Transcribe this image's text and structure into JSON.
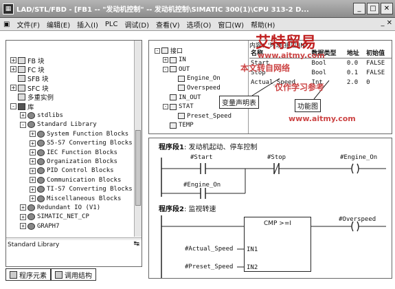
{
  "window": {
    "title": "LAD/STL/FBD  - [FB1 -- \"发动机控制\" -- 发动机控制\\SIMATIC 300(1)\\CPU 313-2 D...",
    "buttons": [
      "_",
      "□",
      "✕"
    ]
  },
  "menu": {
    "items": [
      "文件(F)",
      "编辑(E)",
      "插入(I)",
      "PLC",
      "调试(D)",
      "查看(V)",
      "选项(O)",
      "窗口(W)",
      "帮助(H)"
    ],
    "controls": "_ ✕"
  },
  "left_tree": {
    "items": [
      {
        "label": "FB 块",
        "level": 0,
        "exp": "+"
      },
      {
        "label": "FC 块",
        "level": 0,
        "exp": "+"
      },
      {
        "label": "SFB 块",
        "level": 0,
        "exp": ""
      },
      {
        "label": "SFC 块",
        "level": 0,
        "exp": "+"
      },
      {
        "label": "多重实例",
        "level": 0,
        "exp": ""
      },
      {
        "label": "库",
        "level": 0,
        "exp": "-"
      },
      {
        "label": "stdlibs",
        "level": 1,
        "exp": "+"
      },
      {
        "label": "Standard Library",
        "level": 1,
        "exp": "-"
      },
      {
        "label": "System Function Blocks",
        "level": 2,
        "exp": "+"
      },
      {
        "label": "S5-S7 Converting Blocks",
        "level": 2,
        "exp": "+"
      },
      {
        "label": "IEC Function Blocks",
        "level": 2,
        "exp": "+"
      },
      {
        "label": "Organization Blocks",
        "level": 2,
        "exp": "+"
      },
      {
        "label": "PID Control Blocks",
        "level": 2,
        "exp": "+"
      },
      {
        "label": "Communication Blocks",
        "level": 2,
        "exp": "+"
      },
      {
        "label": "TI-S7 Converting Blocks",
        "level": 2,
        "exp": "+"
      },
      {
        "label": "Miscellaneous Blocks",
        "level": 2,
        "exp": "+"
      },
      {
        "label": "Redundant IO (V1)",
        "level": 1,
        "exp": "+"
      },
      {
        "label": "SIMATIC_NET_CP",
        "level": 1,
        "exp": "+"
      },
      {
        "label": "GRAPH7",
        "level": 1,
        "exp": "+"
      }
    ],
    "status": "Standard Library"
  },
  "bottom_tabs": [
    "程序元素",
    "调用结构"
  ],
  "interface": {
    "header": "内容：'环境\\接口\\IN'",
    "tree": [
      {
        "label": "接口",
        "level": 0,
        "exp": "-"
      },
      {
        "label": "IN",
        "level": 1,
        "exp": "+"
      },
      {
        "label": "OUT",
        "level": 1,
        "exp": "-"
      },
      {
        "label": "Engine_On",
        "level": 2,
        "exp": ""
      },
      {
        "label": "Overspeed",
        "level": 2,
        "exp": ""
      },
      {
        "label": "IN_OUT",
        "level": 1,
        "exp": ""
      },
      {
        "label": "STAT",
        "level": 1,
        "exp": "-"
      },
      {
        "label": "Preset_Speed",
        "level": 2,
        "exp": ""
      },
      {
        "label": "TEMP",
        "level": 1,
        "exp": ""
      }
    ],
    "columns": [
      "名称",
      "数据类型",
      "地址",
      "初始值"
    ],
    "rows": [
      [
        "Start",
        "Bool",
        "0.0",
        "FALSE"
      ],
      [
        "Stop",
        "Bool",
        "0.1",
        "FALSE"
      ],
      [
        "Actual_Speed",
        "Int",
        "2.0",
        "0"
      ]
    ],
    "callouts": [
      "变量声明表",
      "功能图"
    ]
  },
  "ladder": {
    "net1_title": "程序段1",
    "net1_label": ": 发动机起动、停车控制",
    "net1_ops": [
      "#Start",
      "#Stop",
      "#Engine_On",
      "#Engine_On"
    ],
    "net2_title": "程序段2",
    "net2_label": ": 监视转速",
    "cmp_title": "CMP >=I",
    "cmp_in1": "IN1",
    "cmp_in2": "IN2",
    "net2_ops": [
      "#Actual_Speed",
      "#Preset_Speed",
      "#Overspeed"
    ]
  },
  "watermark": {
    "brand": "艾特贸易",
    "url": "www.aitmy.com",
    "line1": "本文转自网络",
    "line2": "仅作学习参考",
    "url2": "www.aitmy.com"
  }
}
